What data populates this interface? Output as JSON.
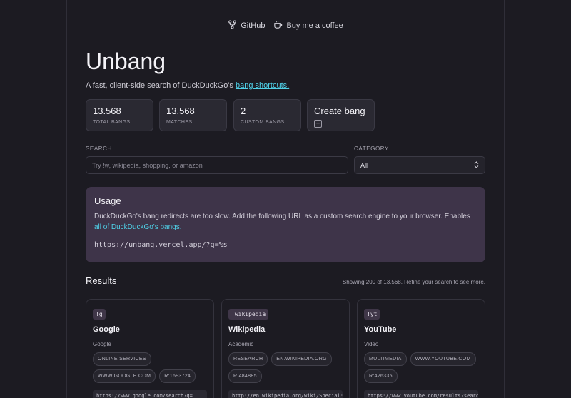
{
  "toplinks": {
    "github": "GitHub",
    "coffee": "Buy me a coffee"
  },
  "header": {
    "title": "Unbang",
    "subtitle_prefix": "A fast, client-side search of DuckDuckGo's ",
    "subtitle_link": "bang shortcuts."
  },
  "stats": [
    {
      "num": "13.568",
      "label": "TOTAL BANGS"
    },
    {
      "num": "13.568",
      "label": "MATCHES"
    },
    {
      "num": "2",
      "label": "CUSTOM BANGS"
    }
  ],
  "create": {
    "label": "Create bang",
    "plus": "+"
  },
  "search": {
    "label": "SEARCH",
    "placeholder": "Try !w, wikipedia, shopping, or amazon"
  },
  "category": {
    "label": "CATEGORY",
    "value": "All"
  },
  "usage": {
    "title": "Usage",
    "text": "DuckDuckGo's bang redirects are too slow. Add the following URL as a custom search engine to your browser. Enables ",
    "link": "all of DuckDuckGo's bangs.",
    "url": "https://unbang.vercel.app/?q=%s"
  },
  "results": {
    "title": "Results",
    "meta": "Showing 200 of 13.568. Refine your search to see more.",
    "cards": [
      {
        "trigger": "!g",
        "name": "Google",
        "category": "Google",
        "tags": [
          "ONLINE SERVICES",
          "WWW.GOOGLE.COM",
          "R:1693724"
        ],
        "url": "https://www.google.com/search?q="
      },
      {
        "trigger": "!wikipedia",
        "name": "Wikipedia",
        "category": "Academic",
        "tags": [
          "RESEARCH",
          "EN.WIKIPEDIA.ORG",
          "R:484885"
        ],
        "url": "http://en.wikipedia.org/wiki/Special:S"
      },
      {
        "trigger": "!yt",
        "name": "YouTube",
        "category": "Video",
        "tags": [
          "MULTIMEDIA",
          "WWW.YOUTUBE.COM",
          "R:426335"
        ],
        "url": "https://www.youtube.com/results?search"
      }
    ]
  }
}
